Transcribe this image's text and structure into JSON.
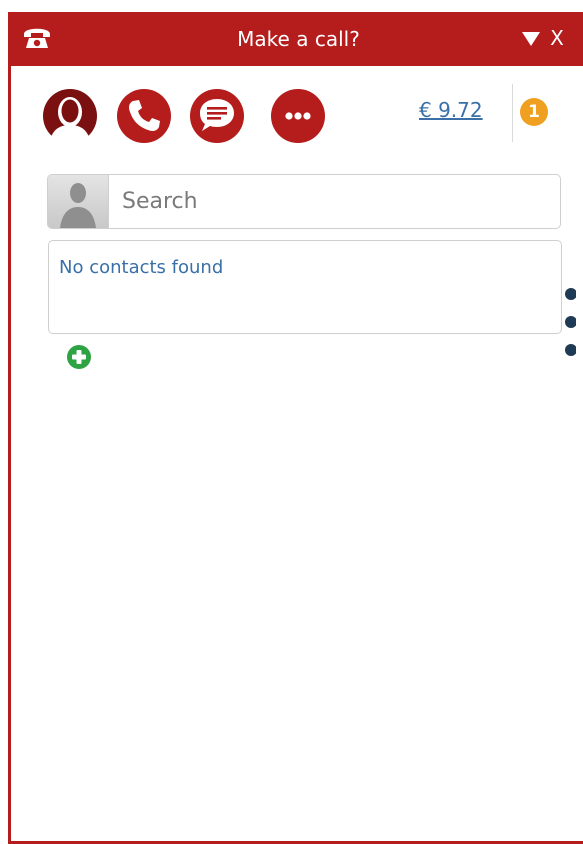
{
  "window": {
    "title": "Make a call?",
    "close_label": "X"
  },
  "icons": {
    "phone": "telephone-icon",
    "minimize": "triangle-down-icon",
    "contacts": "person-icon",
    "call": "phone-handset-icon",
    "message": "chat-bubble-icon",
    "more": "ellipsis-icon",
    "avatar": "user-placeholder-icon",
    "add": "plus-circle-icon",
    "side_menu": "vertical-dots-icon"
  },
  "toolbar": {
    "balance": "€ 9.72",
    "notification_count": "1"
  },
  "search": {
    "placeholder": "Search",
    "value": ""
  },
  "contacts": {
    "empty_message": "No contacts found"
  },
  "colors": {
    "brand_red": "#b51c1c",
    "dark_red": "#7a1010",
    "link_blue": "#3a6fa8",
    "badge_orange": "#f0a020",
    "add_green": "#2ea344",
    "dot_navy": "#1f3a55"
  }
}
